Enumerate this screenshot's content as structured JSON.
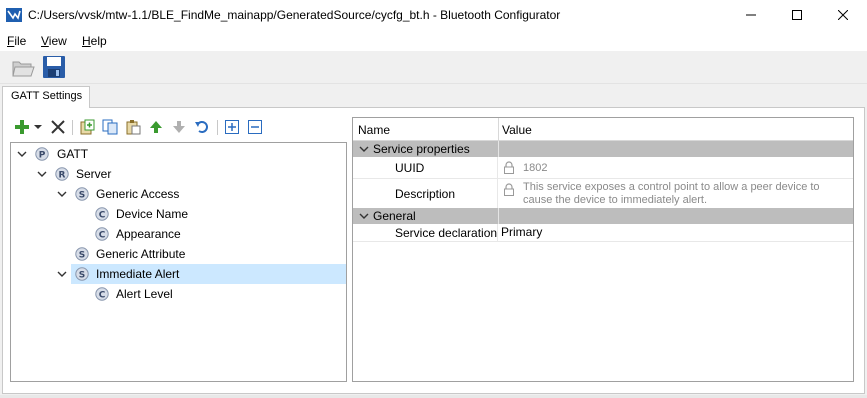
{
  "window": {
    "title": "C:/Users/vvsk/mtw-1.1/BLE_FindMe_mainapp/GeneratedSource/cycfg_bt.h - Bluetooth Configurator",
    "accent": "#0078d7"
  },
  "menu": {
    "file": {
      "accel": "F",
      "rest": "ile"
    },
    "view": {
      "accel": "V",
      "rest": "iew"
    },
    "help": {
      "accel": "H",
      "rest": "elp"
    }
  },
  "toolbar": {
    "open_icon": "open-folder-icon",
    "save_icon": "save-disk-icon"
  },
  "tabs": [
    {
      "label": "GATT Settings",
      "active": true
    }
  ],
  "tree_toolbar": {
    "icons": [
      "add-icon",
      "add-dropdown-icon",
      "delete-icon",
      "paste-special-icon",
      "copy-icon",
      "paste-icon",
      "move-up-icon",
      "move-down-icon",
      "undo-icon",
      "expand-all-icon",
      "collapse-all-icon"
    ]
  },
  "tree": {
    "nodes": [
      {
        "badge": "P",
        "label": "GATT",
        "expanded": true
      },
      {
        "badge": "R",
        "label": "Server",
        "expanded": true
      },
      {
        "badge": "S",
        "label": "Generic Access",
        "expanded": true
      },
      {
        "badge": "C",
        "label": "Device Name"
      },
      {
        "badge": "C",
        "label": "Appearance"
      },
      {
        "badge": "S",
        "label": "Generic Attribute"
      },
      {
        "badge": "S",
        "label": "Immediate Alert",
        "expanded": true,
        "selected": true
      },
      {
        "badge": "C",
        "label": "Alert Level"
      }
    ]
  },
  "properties": {
    "header": {
      "name": "Name",
      "value": "Value"
    },
    "categories": [
      {
        "label": "Service properties",
        "rows": [
          {
            "name": "UUID",
            "value": "1802",
            "readonly": true
          },
          {
            "name": "Description",
            "value_line1": "This service exposes a control point to allow a peer device to",
            "value_line2": "cause the device to immediately alert.",
            "readonly": true
          }
        ]
      },
      {
        "label": "General",
        "rows": [
          {
            "name": "Service declaration",
            "value": "Primary",
            "readonly": false
          }
        ]
      }
    ]
  },
  "colors": {
    "selection": "#cce8ff",
    "category_bg": "#bdbdbd",
    "readonly_text": "#8a8a8a",
    "green_action": "#3a9a2f",
    "blue_action": "#2a6cc0"
  }
}
